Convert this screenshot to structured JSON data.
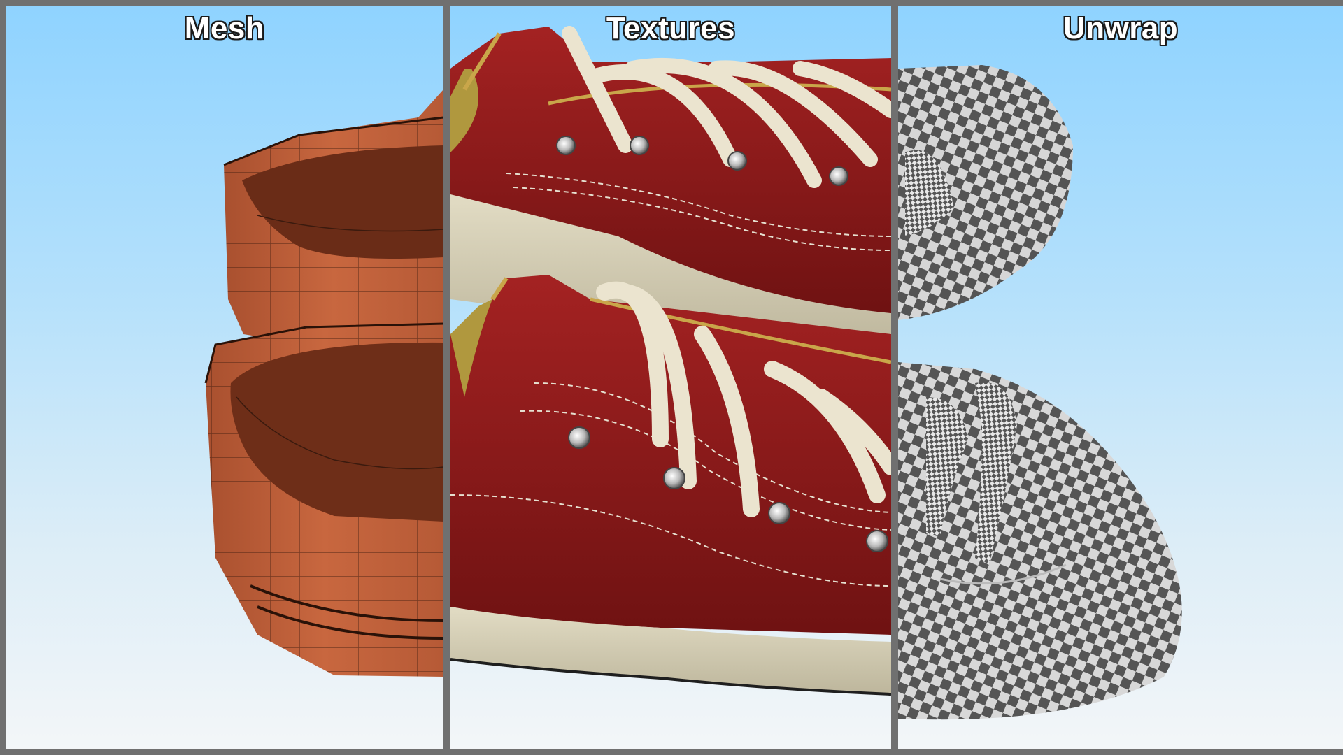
{
  "panels": [
    {
      "title": "Mesh",
      "render": "wireframe shoe mesh (terracotta)"
    },
    {
      "title": "Textures",
      "render": "red canvas sneakers with cream laces"
    },
    {
      "title": "Unwrap",
      "render": "checker UV test pattern on shoe"
    }
  ],
  "colors": {
    "sky_top": "#8fd3ff",
    "sky_bottom": "#f3f6f8",
    "divider": "#707070",
    "mesh": "#c0603b",
    "canvas_red": "#8e1a1a",
    "lace": "#ebe4cf",
    "sole": "#d8d2b8"
  }
}
